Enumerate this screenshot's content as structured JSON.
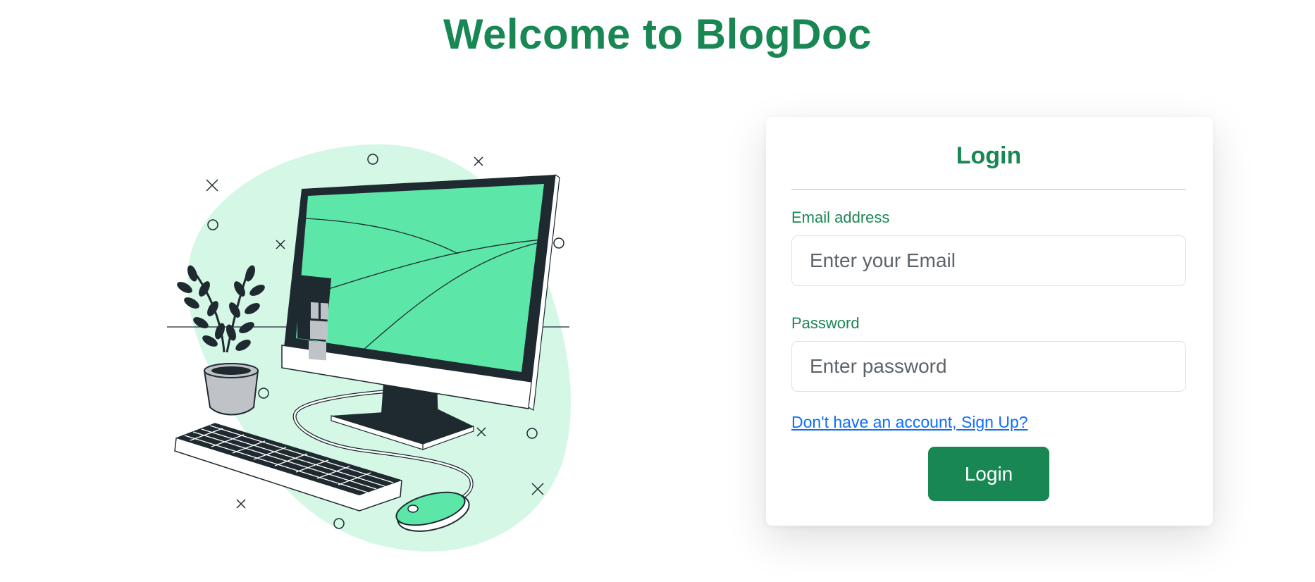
{
  "header": {
    "title": "Welcome to BlogDoc"
  },
  "login_form": {
    "title": "Login",
    "email": {
      "label": "Email address",
      "placeholder": "Enter your Email",
      "value": ""
    },
    "password": {
      "label": "Password",
      "placeholder": "Enter password",
      "value": ""
    },
    "signup_link": "Don't have an account, Sign Up?",
    "submit_label": "Login"
  },
  "colors": {
    "brand_green": "#198754",
    "screen_green": "#5ce6a8",
    "blob_green": "#d5f7e6",
    "dark": "#1f2a30",
    "link_blue": "#0d6efd"
  },
  "illustration": {
    "name": "desktop-computer-illustration",
    "elements": [
      "monitor",
      "keyboard",
      "mouse",
      "potted-plant"
    ]
  }
}
